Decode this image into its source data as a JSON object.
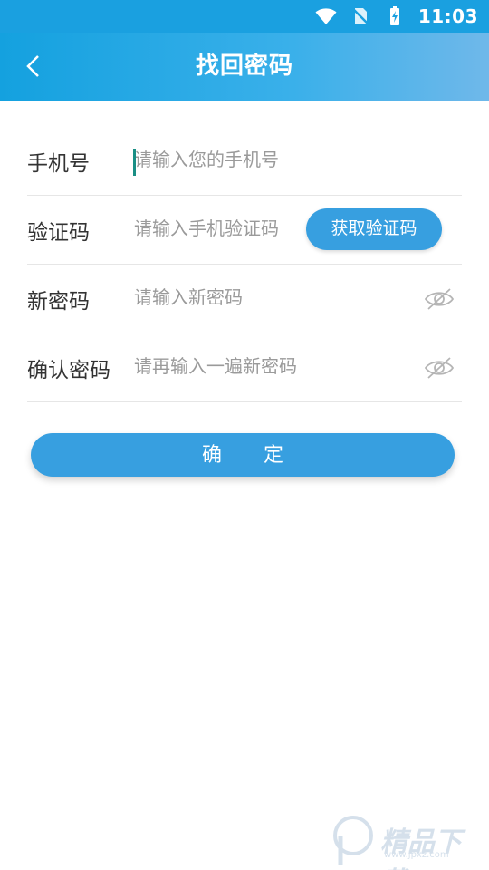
{
  "status_bar": {
    "time": "11:03",
    "icons": [
      "wifi-icon",
      "no-sim-icon",
      "battery-charging-icon"
    ]
  },
  "app_bar": {
    "title": "找回密码",
    "back_icon": "chevron-left-icon"
  },
  "form": {
    "phone": {
      "label": "手机号",
      "placeholder": "请输入您的手机号"
    },
    "code": {
      "label": "验证码",
      "placeholder": "请输入手机验证码",
      "button_label": "获取验证码"
    },
    "new_password": {
      "label": "新密码",
      "placeholder": "请输入新密码",
      "toggle_icon": "eye-hidden-icon"
    },
    "confirm_password": {
      "label": "确认密码",
      "placeholder": "请再输入一遍新密码",
      "toggle_icon": "eye-hidden-icon"
    }
  },
  "confirm_button": {
    "label": "确 定"
  },
  "colors": {
    "primary": "#379fe0",
    "appbar": "#1aa0e0",
    "text": "#333333",
    "placeholder": "#9a9a9a",
    "divider": "#e6e6e6"
  },
  "watermark": {
    "text": "精品下载",
    "url": "www.jpxz.com"
  }
}
